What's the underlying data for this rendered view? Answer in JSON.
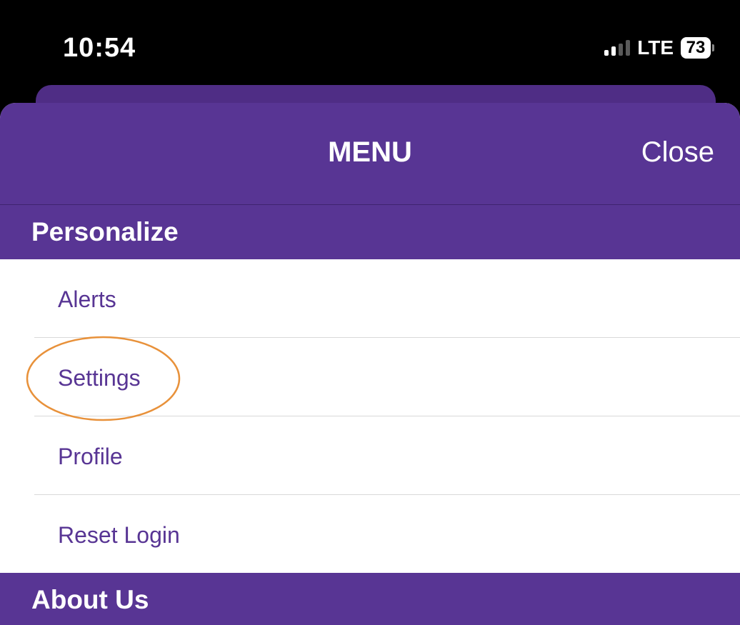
{
  "status_bar": {
    "time": "10:54",
    "network": "LTE",
    "battery": "73",
    "signal_bars_active": 2,
    "signal_bars_total": 4
  },
  "nav": {
    "title": "MENU",
    "close_label": "Close"
  },
  "sections": [
    {
      "title": "Personalize",
      "items": [
        {
          "label": "Alerts"
        },
        {
          "label": "Settings"
        },
        {
          "label": "Profile"
        },
        {
          "label": "Reset Login"
        }
      ]
    },
    {
      "title": "About Us",
      "items": []
    }
  ],
  "annotation": {
    "highlighted_item": "Settings",
    "color": "#e8913a"
  },
  "colors": {
    "brand_purple": "#583594",
    "back_sheet": "#4f2d85",
    "item_text": "#583594",
    "divider": "#d9d9d9",
    "status_bar_bg": "#000000"
  },
  "icons": [
    "cellular-signal-icon",
    "battery-icon"
  ]
}
